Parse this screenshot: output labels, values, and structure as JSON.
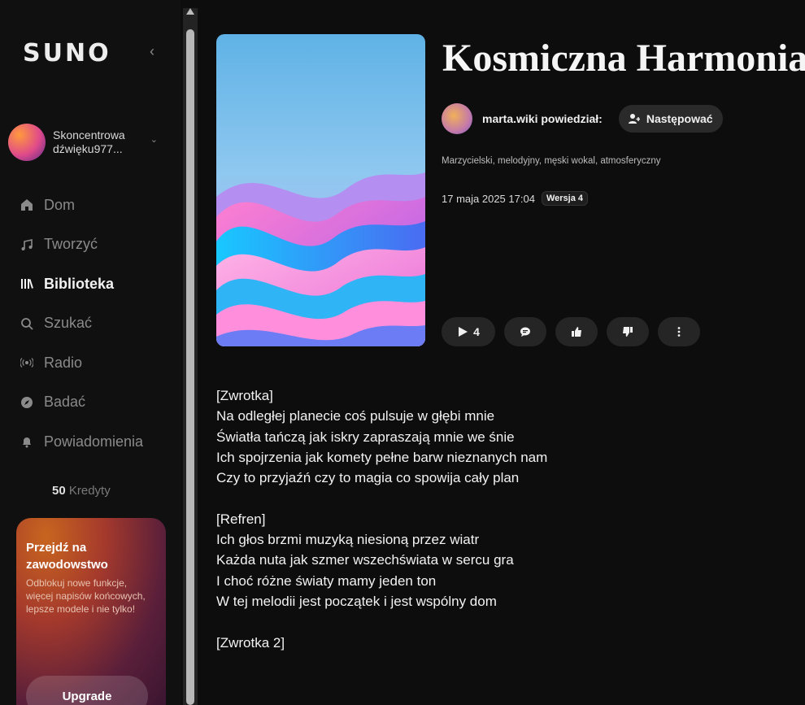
{
  "sidebar": {
    "logo": "SUNO",
    "collapse_icon": "‹",
    "profile": {
      "line1": "Skoncentrowa",
      "line2": "dźwięku977..."
    },
    "nav": [
      {
        "label": "Dom",
        "icon": "home-icon",
        "active": false
      },
      {
        "label": "Tworzyć",
        "icon": "music-note-icon",
        "active": false
      },
      {
        "label": "Biblioteka",
        "icon": "library-icon",
        "active": true
      },
      {
        "label": "Szukać",
        "icon": "search-icon",
        "active": false
      },
      {
        "label": "Radio",
        "icon": "radio-icon",
        "active": false
      },
      {
        "label": "Badać",
        "icon": "compass-icon",
        "active": false
      },
      {
        "label": "Powiadomienia",
        "icon": "bell-icon",
        "active": false
      }
    ],
    "credits": {
      "amount": "50",
      "label": "Kredyty"
    },
    "promo": {
      "title": "Przejdź na zawodowstwo",
      "text": "Odblokuj nowe funkcje, więcej napisów końcowych, lepsze modele i nie tylko!",
      "button": "Upgrade"
    }
  },
  "song": {
    "title": "Kosmiczna Harmonia",
    "author": "marta.wiki powiedział:",
    "follow_label": "Następować",
    "tags": "Marzycielski, melodyjny, męski wokal, atmosferyczny",
    "date": "17 maja 2025 17:04",
    "version": "Wersja 4",
    "play_count": "4"
  },
  "lyrics": [
    [
      "[Zwrotka]",
      "Na odległej planecie coś pulsuje w głębi mnie",
      "Światła tańczą jak iskry zapraszają mnie we śnie",
      "Ich spojrzenia jak komety pełne barw nieznanych nam",
      "Czy to przyjaźń czy to magia co spowija cały plan"
    ],
    [
      "[Refren]",
      "Ich głos brzmi muzyką niesioną przez wiatr",
      "Każda nuta jak szmer wszechświata w sercu gra",
      "I choć różne światy mamy jeden ton",
      "W tej melodii jest początek i jest wspólny dom"
    ],
    [
      "[Zwrotka 2]"
    ]
  ]
}
